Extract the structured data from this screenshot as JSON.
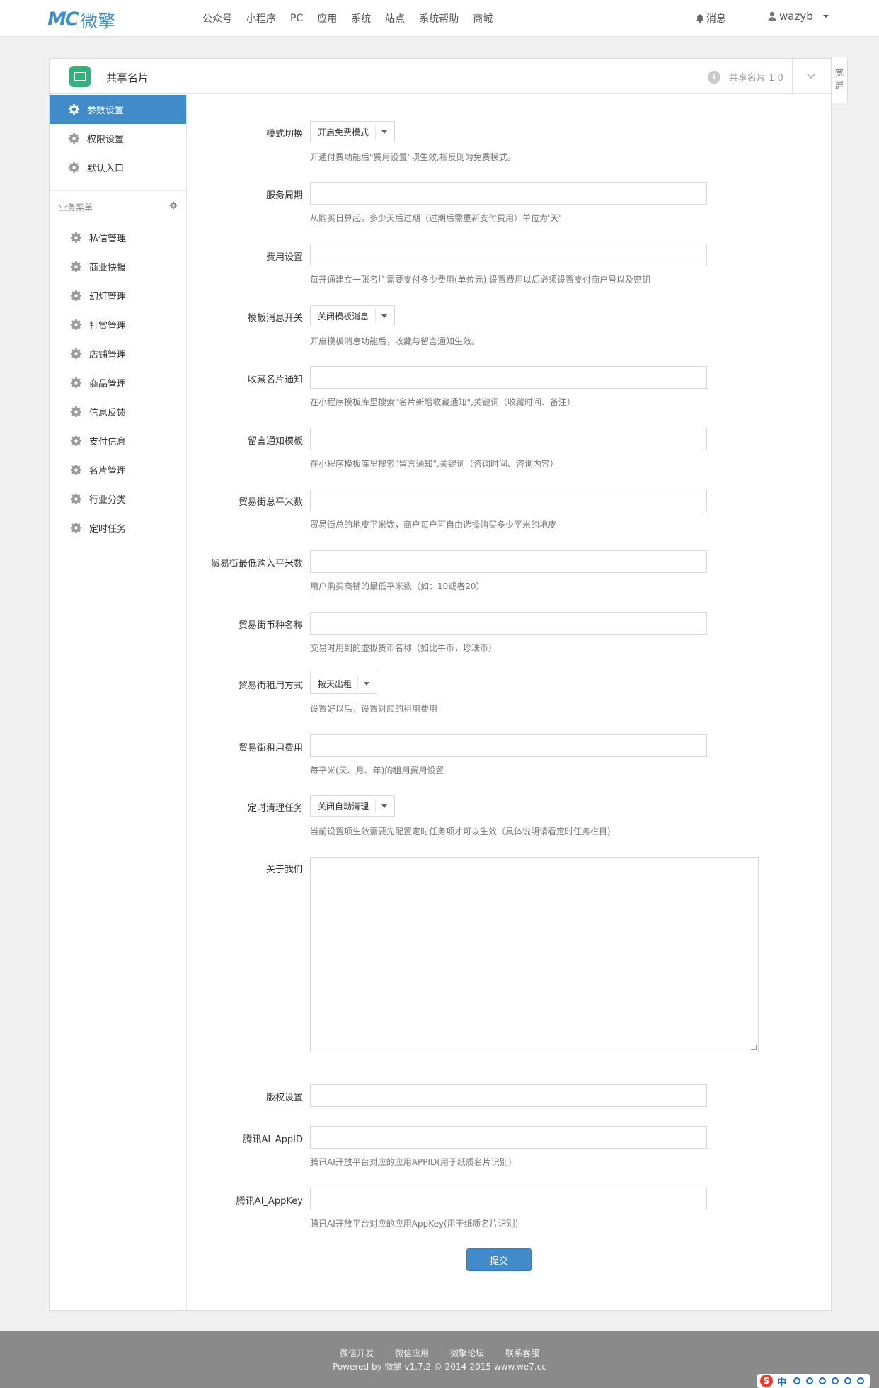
{
  "brand": {
    "logo_mark": "MC",
    "logo_text": "微擎"
  },
  "topnav": [
    "公众号",
    "小程序",
    "PC",
    "应用",
    "系统",
    "站点",
    "系统帮助",
    "商城"
  ],
  "top_right": {
    "messages": "消息",
    "username": "wazyb"
  },
  "panel": {
    "app_name": "共享名片",
    "app_version": "共享名片 1.0",
    "wide_screen": "宽屏"
  },
  "sidebar": {
    "top_items": [
      {
        "label": "参数设置",
        "active": true
      },
      {
        "label": "权限设置",
        "active": false
      },
      {
        "label": "默认入口",
        "active": false
      }
    ],
    "group_title": "业务菜单",
    "items": [
      "私信管理",
      "商业快报",
      "幻灯管理",
      "打赏管理",
      "店铺管理",
      "商品管理",
      "信息反馈",
      "支付信息",
      "名片管理",
      "行业分类",
      "定时任务"
    ]
  },
  "form": {
    "mode": {
      "label": "模式切换",
      "value": "开启免费模式",
      "help": "开通付费功能后\"费用设置\"项生效,相反则为免费模式。"
    },
    "service_period": {
      "label": "服务周期",
      "value": "",
      "help": "从购买日算起，多少天后过期（过期后需重新支付费用）单位为'天'"
    },
    "fee": {
      "label": "费用设置",
      "value": "",
      "help": "每开通建立一张名片需要支付多少费用(单位元),设置费用以后必须设置支付商户号以及密钥"
    },
    "template_switch": {
      "label": "模板消息开关",
      "value": "关闭模板消息",
      "help": "开启模板消息功能后，收藏与留言通知生效。"
    },
    "collect_notice": {
      "label": "收藏名片通知",
      "value": "",
      "help": "在小程序模板库里搜索\"名片新增收藏通知\",关键词（收藏时间、备注）"
    },
    "message_template": {
      "label": "留言通知模板",
      "value": "",
      "help": "在小程序模板库里搜索\"留言通知\",关键词（咨询时间、咨询内容）"
    },
    "street_total": {
      "label": "贸易街总平米数",
      "value": "",
      "help": "贸易街总的地皮平米数，商户每户可自由选择购买多少平米的地皮"
    },
    "street_min": {
      "label": "贸易街最低购入平米数",
      "value": "",
      "help": "用户购买商铺的最低平米数（如：10或者20）"
    },
    "street_currency": {
      "label": "贸易街币种名称",
      "value": "",
      "help": "交易时用到的虚拟货币名称（如比牛币，珍珠币）"
    },
    "rent_mode": {
      "label": "贸易街租用方式",
      "value": "按天出租",
      "help": "设置好以后，设置对应的租用费用"
    },
    "rent_fee": {
      "label": "贸易街租用费用",
      "value": "",
      "help": "每平米(天、月、年)的租用费用设置"
    },
    "cleanup": {
      "label": "定时清理任务",
      "value": "关闭自动清理",
      "help": "当前设置项生效需要先配置定时任务项才可以生效（具体说明请看定时任务栏目）"
    },
    "about": {
      "label": "关于我们",
      "value": ""
    },
    "copyright": {
      "label": "版权设置",
      "value": ""
    },
    "ai_appid": {
      "label": "腾讯AI_AppID",
      "value": "",
      "help": "腾讯AI开放平台对应的应用APPID(用于纸质名片识别)"
    },
    "ai_appkey": {
      "label": "腾讯AI_AppKey",
      "value": "",
      "help": "腾讯AI开放平台对应的应用AppKey(用于纸质名片识别)"
    },
    "submit": "提交"
  },
  "footer": {
    "links": [
      "微信开发",
      "微信应用",
      "微擎论坛",
      "联系客服"
    ],
    "copyright": "Powered by 微擎 v1.7.2 © 2014-2015 www.we7.cc"
  },
  "ime": {
    "label": "中"
  },
  "colors": {
    "primary": "#428bca",
    "logo": "#3e8ed0",
    "app_icon": "#2fb37a",
    "footer": "#8a8a8a"
  }
}
